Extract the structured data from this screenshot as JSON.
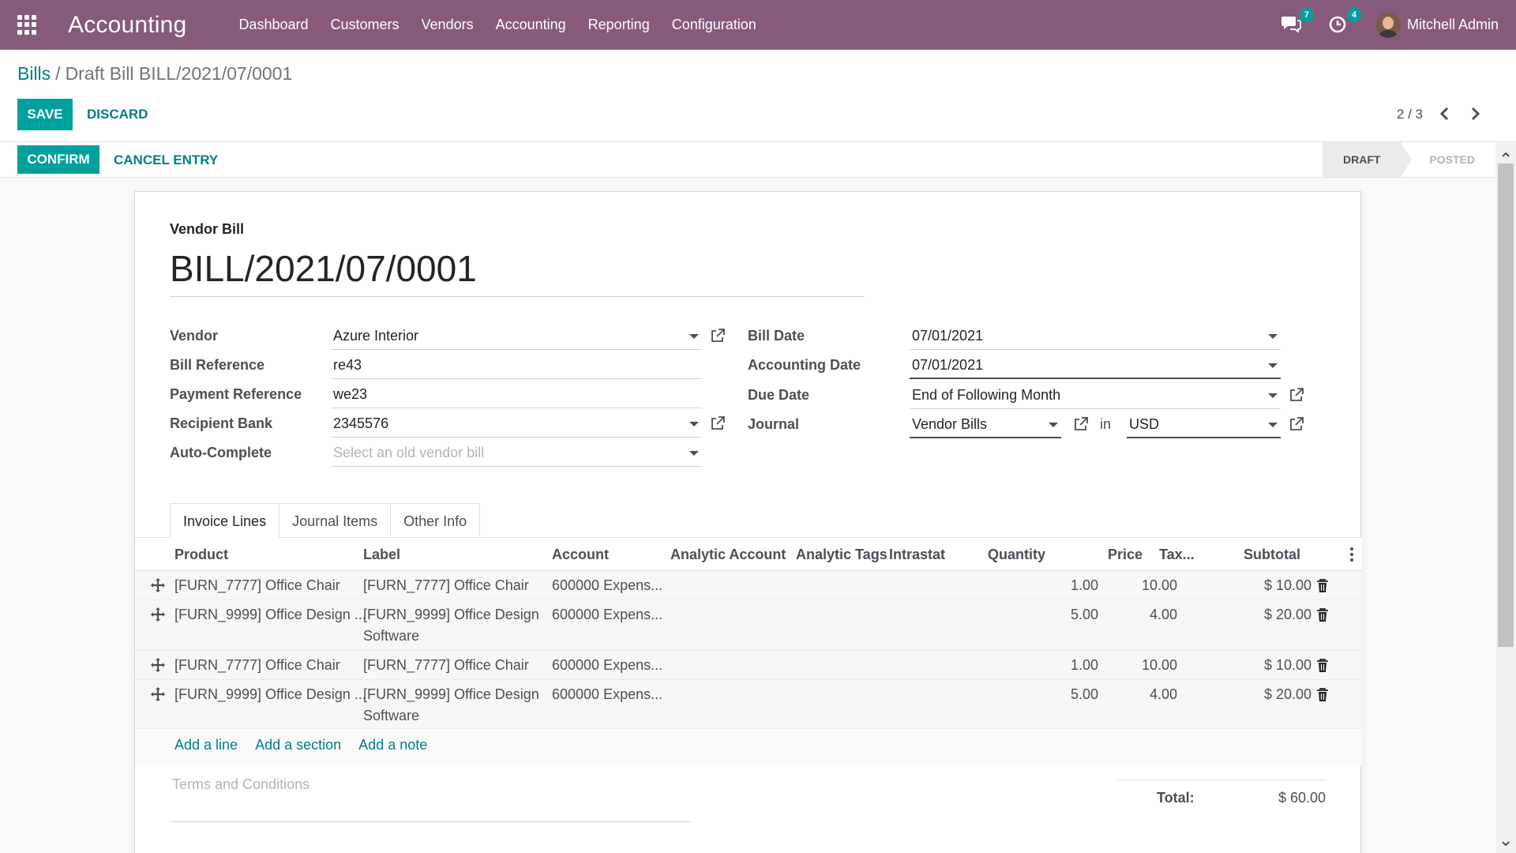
{
  "app": {
    "title": "Accounting",
    "menu": [
      "Dashboard",
      "Customers",
      "Vendors",
      "Accounting",
      "Reporting",
      "Configuration"
    ],
    "messages_count": "7",
    "activities_count": "4",
    "user_name": "Mitchell Admin"
  },
  "breadcrumb": {
    "parent": "Bills",
    "separator": "/",
    "current": "Draft Bill BILL/2021/07/0001"
  },
  "toolbar": {
    "save": "SAVE",
    "discard": "DISCARD",
    "pager": "2 / 3"
  },
  "header_buttons": {
    "confirm": "CONFIRM",
    "cancel_entry": "CANCEL ENTRY"
  },
  "status": {
    "stages": [
      "DRAFT",
      "POSTED"
    ],
    "current": "DRAFT"
  },
  "bill": {
    "type_label": "Vendor Bill",
    "name": "BILL/2021/07/0001"
  },
  "fields": {
    "vendor": {
      "label": "Vendor",
      "value": "Azure Interior"
    },
    "bill_reference": {
      "label": "Bill Reference",
      "value": "re43"
    },
    "payment_reference": {
      "label": "Payment Reference",
      "value": "we23"
    },
    "recipient_bank": {
      "label": "Recipient Bank",
      "value": "2345576"
    },
    "auto_complete": {
      "label": "Auto-Complete",
      "placeholder": "Select an old vendor bill"
    },
    "bill_date": {
      "label": "Bill Date",
      "value": "07/01/2021"
    },
    "accounting_date": {
      "label": "Accounting Date",
      "value": "07/01/2021"
    },
    "due_date": {
      "label": "Due Date",
      "value": "End of Following Month"
    },
    "journal": {
      "label": "Journal",
      "value": "Vendor Bills",
      "in_label": "in",
      "currency": "USD"
    }
  },
  "tabs": [
    "Invoice Lines",
    "Journal Items",
    "Other Info"
  ],
  "table": {
    "columns": {
      "product": "Product",
      "label": "Label",
      "account": "Account",
      "analytic_account": "Analytic Account",
      "analytic_tags": "Analytic Tags",
      "intrastat": "Intrastat",
      "quantity": "Quantity",
      "price": "Price",
      "taxes": "Tax...",
      "subtotal": "Subtotal"
    },
    "rows": [
      {
        "product": "[FURN_7777] Office Chair",
        "label": "[FURN_7777] Office Chair",
        "label2": "",
        "account": "600000 Expens...",
        "quantity": "1.00",
        "price": "10.00",
        "subtotal": "$ 10.00"
      },
      {
        "product": "[FURN_9999] Office Design ...",
        "label": "[FURN_9999] Office Design",
        "label2": "Software",
        "account": "600000 Expens...",
        "quantity": "5.00",
        "price": "4.00",
        "subtotal": "$ 20.00"
      },
      {
        "product": "[FURN_7777] Office Chair",
        "label": "[FURN_7777] Office Chair",
        "label2": "",
        "account": "600000 Expens...",
        "quantity": "1.00",
        "price": "10.00",
        "subtotal": "$ 10.00"
      },
      {
        "product": "[FURN_9999] Office Design ...",
        "label": "[FURN_9999] Office Design",
        "label2": "Software",
        "account": "600000 Expens...",
        "quantity": "5.00",
        "price": "4.00",
        "subtotal": "$ 20.00"
      }
    ],
    "add_line": "Add a line",
    "add_section": "Add a section",
    "add_note": "Add a note"
  },
  "terms_placeholder": "Terms and Conditions",
  "totals": {
    "label": "Total:",
    "value": "$ 60.00"
  }
}
